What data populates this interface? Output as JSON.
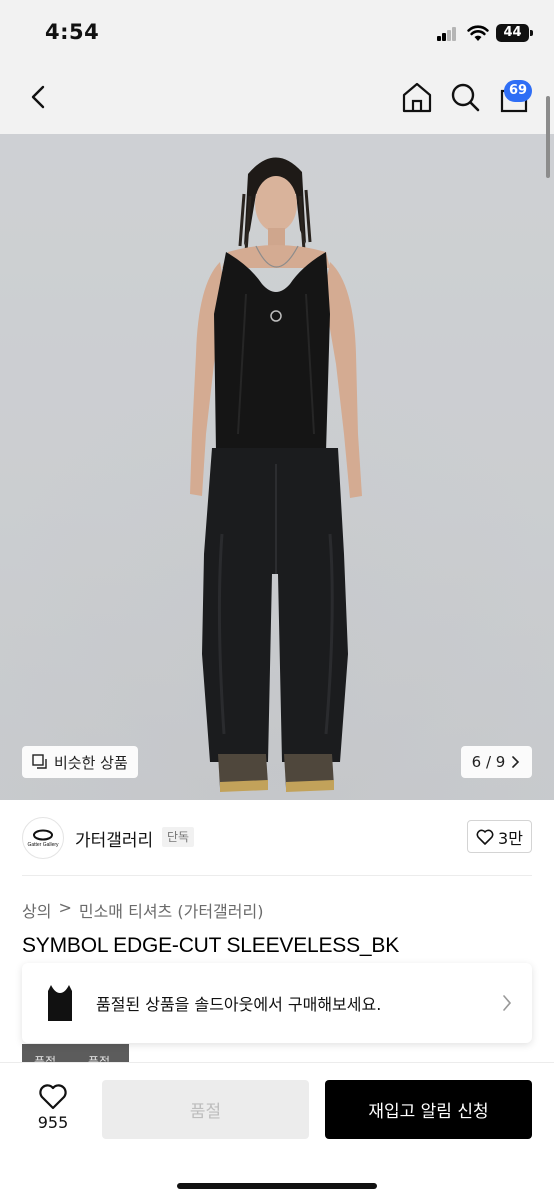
{
  "status_bar": {
    "time": "4:54",
    "battery_level": "44",
    "icons": [
      "signal-icon",
      "wifi-icon",
      "battery-icon"
    ]
  },
  "nav": {
    "icons": [
      "back-arrow-icon",
      "home-icon",
      "search-icon",
      "shopping-bag-icon"
    ],
    "cart_count": "69"
  },
  "gallery": {
    "similar_label": "비슷한 상품",
    "counter": "6 / 9"
  },
  "brand": {
    "logo_text": "Gatter Gallery",
    "name": "가터갤러리",
    "tag": "단독",
    "likes": "3만"
  },
  "product": {
    "breadcrumb": [
      "상의",
      "민소매 티셔츠 (가터갤러리)"
    ],
    "title": "SYMBOL EDGE-CUT SLEEVELESS_BK"
  },
  "soldout_banner": {
    "text": "품절된 상품을 솔드아웃에서 구매해보세요."
  },
  "thumb_strip": {
    "labels": [
      "품절",
      "품절"
    ]
  },
  "bottom_bar": {
    "wish_count": "955",
    "soldout_label": "품절",
    "restock_label": "재입고 알림 신청"
  },
  "colors": {
    "accent_badge": "#2f6ef5",
    "primary_button": "#000000",
    "disabled_button": "#ececec"
  }
}
